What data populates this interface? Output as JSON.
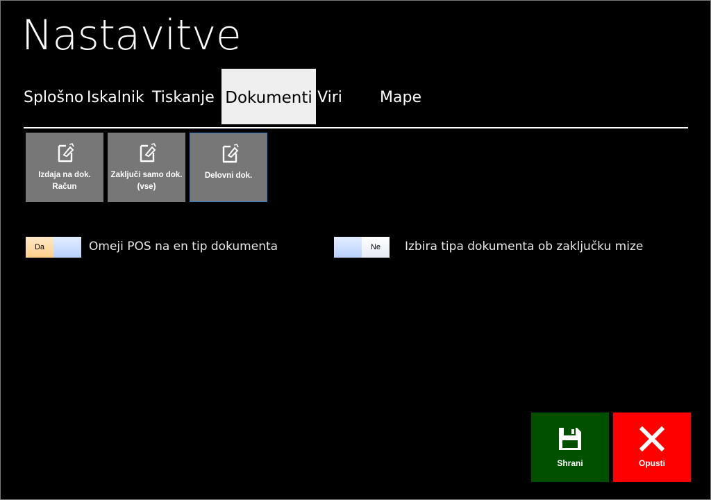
{
  "window": {
    "title": "Nastavitve"
  },
  "tabs": [
    {
      "label": "Splošno",
      "active": false
    },
    {
      "label": "Iskalnik",
      "active": false
    },
    {
      "label": "Tiskanje",
      "active": false
    },
    {
      "label": "Dokumenti",
      "active": true
    },
    {
      "label": "Viri",
      "active": false
    },
    {
      "label": "Mape",
      "active": false
    }
  ],
  "documents": [
    {
      "line1": "Izdaja na dok.",
      "line2": "Račun",
      "icon": "edit-document-icon",
      "selected": false
    },
    {
      "line1": "Zaključi samo dok.",
      "line2": "(vse)",
      "icon": "edit-document-icon",
      "selected": false
    },
    {
      "line1": "Delovni dok.",
      "line2": "",
      "icon": "edit-document-icon",
      "selected": true
    }
  ],
  "toggles": [
    {
      "state_label": "Da",
      "value": true,
      "label": "Omeji POS na en tip dokumenta"
    },
    {
      "state_label": "Ne",
      "value": false,
      "label": "Izbira tipa dokumenta ob zaključku mize"
    }
  ],
  "actions": {
    "save": {
      "label": "Shrani",
      "icon": "save-icon",
      "color": "#005000"
    },
    "cancel": {
      "label": "Opusti",
      "icon": "close-icon",
      "color": "#ff0000"
    }
  },
  "colors": {
    "background": "#000000",
    "tile": "#777777",
    "active_tab": "#efefef",
    "toggle_on": "#ffd7a0",
    "toggle_track": "#c8dcff",
    "selected_border": "#2f7fcf"
  }
}
